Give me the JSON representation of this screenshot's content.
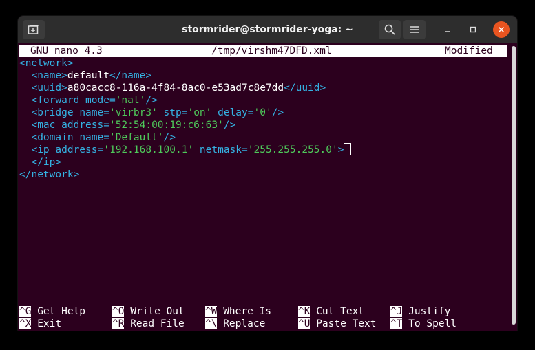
{
  "window": {
    "title": "stormrider@stormrider-yoga: ~"
  },
  "icons": {
    "new_tab": "new-tab-icon",
    "search": "search-icon",
    "menu": "hamburger-menu-icon",
    "minimize": "minimize-icon",
    "maximize": "maximize-icon",
    "close": "close-icon"
  },
  "colors": {
    "terminal_bg": "#2c001e",
    "titlebar_bg": "#2d2d2d",
    "close_button": "#e95420",
    "tag_color": "#34b1e2",
    "value_color": "#4ec95a"
  },
  "nano": {
    "version": "GNU nano 4.3",
    "filename": "/tmp/virshm47DFD.xml",
    "status": "Modified"
  },
  "editor": {
    "lines": [
      {
        "t1": "<network>"
      },
      {
        "open": "<name>",
        "text": "default",
        "close": "</name>"
      },
      {
        "open": "<uuid>",
        "text": "a80cacc8-116a-4f84-8ac0-e53ad7c8e7dd",
        "close": "</uuid>"
      },
      {
        "tag": "<forward ",
        "attr": "mode=",
        "val": "'nat'",
        "end": "/>"
      },
      {
        "tag": "<bridge ",
        "attr1": "name=",
        "val1": "'virbr3'",
        "attr2": " stp=",
        "val2": "'on'",
        "attr3": " delay=",
        "val3": "'0'",
        "end": "/>"
      },
      {
        "tag": "<mac ",
        "attr": "address=",
        "val": "'52:54:00:19:c6:63'",
        "end": "/>"
      },
      {
        "tag": "<domain ",
        "attr": "name=",
        "val": "'Default'",
        "end": "/>"
      },
      {
        "tag": "<ip ",
        "attr1": "address=",
        "val1": "'192.168.100.1'",
        "attr2": " netmask=",
        "val2": "'255.255.255.0'",
        "end": ">"
      },
      {
        "t1": "</ip>"
      },
      {
        "t1": "</network>"
      }
    ]
  },
  "shortcuts": [
    {
      "key": "^G",
      "label": "Get Help"
    },
    {
      "key": "^O",
      "label": "Write Out"
    },
    {
      "key": "^W",
      "label": "Where Is"
    },
    {
      "key": "^K",
      "label": "Cut Text"
    },
    {
      "key": "^J",
      "label": "Justify"
    },
    {
      "key": "^X",
      "label": "Exit"
    },
    {
      "key": "^R",
      "label": "Read File"
    },
    {
      "key": "^\\",
      "label": "Replace"
    },
    {
      "key": "^U",
      "label": "Paste Text"
    },
    {
      "key": "^T",
      "label": "To Spell"
    }
  ]
}
